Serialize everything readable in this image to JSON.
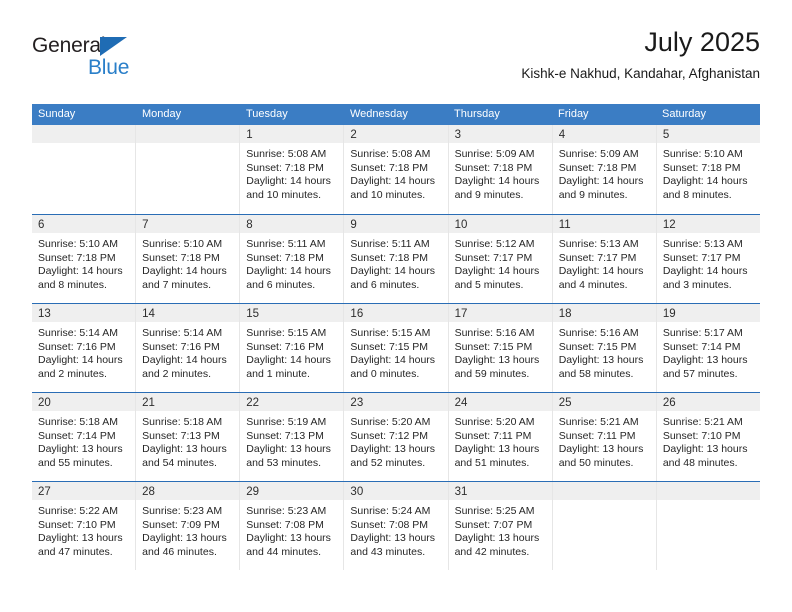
{
  "brand": {
    "name_top": "General",
    "name_bottom": "Blue",
    "accent_color": "#2a7fc9",
    "triangle_color": "#1f6cb4"
  },
  "header": {
    "title": "July 2025",
    "subtitle": "Kishk-e Nakhud, Kandahar, Afghanistan"
  },
  "calendar": {
    "header_background": "#3b7dc4",
    "weekday_text_color": "#ffffff",
    "row_divider_color": "#2a6db5",
    "day_band_background": "#efefef",
    "weekdays": [
      "Sunday",
      "Monday",
      "Tuesday",
      "Wednesday",
      "Thursday",
      "Friday",
      "Saturday"
    ],
    "weeks": [
      [
        {
          "day": "",
          "sunrise": "",
          "sunset": "",
          "daylight_line1": "",
          "daylight_line2": ""
        },
        {
          "day": "",
          "sunrise": "",
          "sunset": "",
          "daylight_line1": "",
          "daylight_line2": ""
        },
        {
          "day": "1",
          "sunrise": "Sunrise: 5:08 AM",
          "sunset": "Sunset: 7:18 PM",
          "daylight_line1": "Daylight: 14 hours",
          "daylight_line2": "and 10 minutes."
        },
        {
          "day": "2",
          "sunrise": "Sunrise: 5:08 AM",
          "sunset": "Sunset: 7:18 PM",
          "daylight_line1": "Daylight: 14 hours",
          "daylight_line2": "and 10 minutes."
        },
        {
          "day": "3",
          "sunrise": "Sunrise: 5:09 AM",
          "sunset": "Sunset: 7:18 PM",
          "daylight_line1": "Daylight: 14 hours",
          "daylight_line2": "and 9 minutes."
        },
        {
          "day": "4",
          "sunrise": "Sunrise: 5:09 AM",
          "sunset": "Sunset: 7:18 PM",
          "daylight_line1": "Daylight: 14 hours",
          "daylight_line2": "and 9 minutes."
        },
        {
          "day": "5",
          "sunrise": "Sunrise: 5:10 AM",
          "sunset": "Sunset: 7:18 PM",
          "daylight_line1": "Daylight: 14 hours",
          "daylight_line2": "and 8 minutes."
        }
      ],
      [
        {
          "day": "6",
          "sunrise": "Sunrise: 5:10 AM",
          "sunset": "Sunset: 7:18 PM",
          "daylight_line1": "Daylight: 14 hours",
          "daylight_line2": "and 8 minutes."
        },
        {
          "day": "7",
          "sunrise": "Sunrise: 5:10 AM",
          "sunset": "Sunset: 7:18 PM",
          "daylight_line1": "Daylight: 14 hours",
          "daylight_line2": "and 7 minutes."
        },
        {
          "day": "8",
          "sunrise": "Sunrise: 5:11 AM",
          "sunset": "Sunset: 7:18 PM",
          "daylight_line1": "Daylight: 14 hours",
          "daylight_line2": "and 6 minutes."
        },
        {
          "day": "9",
          "sunrise": "Sunrise: 5:11 AM",
          "sunset": "Sunset: 7:18 PM",
          "daylight_line1": "Daylight: 14 hours",
          "daylight_line2": "and 6 minutes."
        },
        {
          "day": "10",
          "sunrise": "Sunrise: 5:12 AM",
          "sunset": "Sunset: 7:17 PM",
          "daylight_line1": "Daylight: 14 hours",
          "daylight_line2": "and 5 minutes."
        },
        {
          "day": "11",
          "sunrise": "Sunrise: 5:13 AM",
          "sunset": "Sunset: 7:17 PM",
          "daylight_line1": "Daylight: 14 hours",
          "daylight_line2": "and 4 minutes."
        },
        {
          "day": "12",
          "sunrise": "Sunrise: 5:13 AM",
          "sunset": "Sunset: 7:17 PM",
          "daylight_line1": "Daylight: 14 hours",
          "daylight_line2": "and 3 minutes."
        }
      ],
      [
        {
          "day": "13",
          "sunrise": "Sunrise: 5:14 AM",
          "sunset": "Sunset: 7:16 PM",
          "daylight_line1": "Daylight: 14 hours",
          "daylight_line2": "and 2 minutes."
        },
        {
          "day": "14",
          "sunrise": "Sunrise: 5:14 AM",
          "sunset": "Sunset: 7:16 PM",
          "daylight_line1": "Daylight: 14 hours",
          "daylight_line2": "and 2 minutes."
        },
        {
          "day": "15",
          "sunrise": "Sunrise: 5:15 AM",
          "sunset": "Sunset: 7:16 PM",
          "daylight_line1": "Daylight: 14 hours",
          "daylight_line2": "and 1 minute."
        },
        {
          "day": "16",
          "sunrise": "Sunrise: 5:15 AM",
          "sunset": "Sunset: 7:15 PM",
          "daylight_line1": "Daylight: 14 hours",
          "daylight_line2": "and 0 minutes."
        },
        {
          "day": "17",
          "sunrise": "Sunrise: 5:16 AM",
          "sunset": "Sunset: 7:15 PM",
          "daylight_line1": "Daylight: 13 hours",
          "daylight_line2": "and 59 minutes."
        },
        {
          "day": "18",
          "sunrise": "Sunrise: 5:16 AM",
          "sunset": "Sunset: 7:15 PM",
          "daylight_line1": "Daylight: 13 hours",
          "daylight_line2": "and 58 minutes."
        },
        {
          "day": "19",
          "sunrise": "Sunrise: 5:17 AM",
          "sunset": "Sunset: 7:14 PM",
          "daylight_line1": "Daylight: 13 hours",
          "daylight_line2": "and 57 minutes."
        }
      ],
      [
        {
          "day": "20",
          "sunrise": "Sunrise: 5:18 AM",
          "sunset": "Sunset: 7:14 PM",
          "daylight_line1": "Daylight: 13 hours",
          "daylight_line2": "and 55 minutes."
        },
        {
          "day": "21",
          "sunrise": "Sunrise: 5:18 AM",
          "sunset": "Sunset: 7:13 PM",
          "daylight_line1": "Daylight: 13 hours",
          "daylight_line2": "and 54 minutes."
        },
        {
          "day": "22",
          "sunrise": "Sunrise: 5:19 AM",
          "sunset": "Sunset: 7:13 PM",
          "daylight_line1": "Daylight: 13 hours",
          "daylight_line2": "and 53 minutes."
        },
        {
          "day": "23",
          "sunrise": "Sunrise: 5:20 AM",
          "sunset": "Sunset: 7:12 PM",
          "daylight_line1": "Daylight: 13 hours",
          "daylight_line2": "and 52 minutes."
        },
        {
          "day": "24",
          "sunrise": "Sunrise: 5:20 AM",
          "sunset": "Sunset: 7:11 PM",
          "daylight_line1": "Daylight: 13 hours",
          "daylight_line2": "and 51 minutes."
        },
        {
          "day": "25",
          "sunrise": "Sunrise: 5:21 AM",
          "sunset": "Sunset: 7:11 PM",
          "daylight_line1": "Daylight: 13 hours",
          "daylight_line2": "and 50 minutes."
        },
        {
          "day": "26",
          "sunrise": "Sunrise: 5:21 AM",
          "sunset": "Sunset: 7:10 PM",
          "daylight_line1": "Daylight: 13 hours",
          "daylight_line2": "and 48 minutes."
        }
      ],
      [
        {
          "day": "27",
          "sunrise": "Sunrise: 5:22 AM",
          "sunset": "Sunset: 7:10 PM",
          "daylight_line1": "Daylight: 13 hours",
          "daylight_line2": "and 47 minutes."
        },
        {
          "day": "28",
          "sunrise": "Sunrise: 5:23 AM",
          "sunset": "Sunset: 7:09 PM",
          "daylight_line1": "Daylight: 13 hours",
          "daylight_line2": "and 46 minutes."
        },
        {
          "day": "29",
          "sunrise": "Sunrise: 5:23 AM",
          "sunset": "Sunset: 7:08 PM",
          "daylight_line1": "Daylight: 13 hours",
          "daylight_line2": "and 44 minutes."
        },
        {
          "day": "30",
          "sunrise": "Sunrise: 5:24 AM",
          "sunset": "Sunset: 7:08 PM",
          "daylight_line1": "Daylight: 13 hours",
          "daylight_line2": "and 43 minutes."
        },
        {
          "day": "31",
          "sunrise": "Sunrise: 5:25 AM",
          "sunset": "Sunset: 7:07 PM",
          "daylight_line1": "Daylight: 13 hours",
          "daylight_line2": "and 42 minutes."
        },
        {
          "day": "",
          "sunrise": "",
          "sunset": "",
          "daylight_line1": "",
          "daylight_line2": ""
        },
        {
          "day": "",
          "sunrise": "",
          "sunset": "",
          "daylight_line1": "",
          "daylight_line2": ""
        }
      ]
    ]
  }
}
